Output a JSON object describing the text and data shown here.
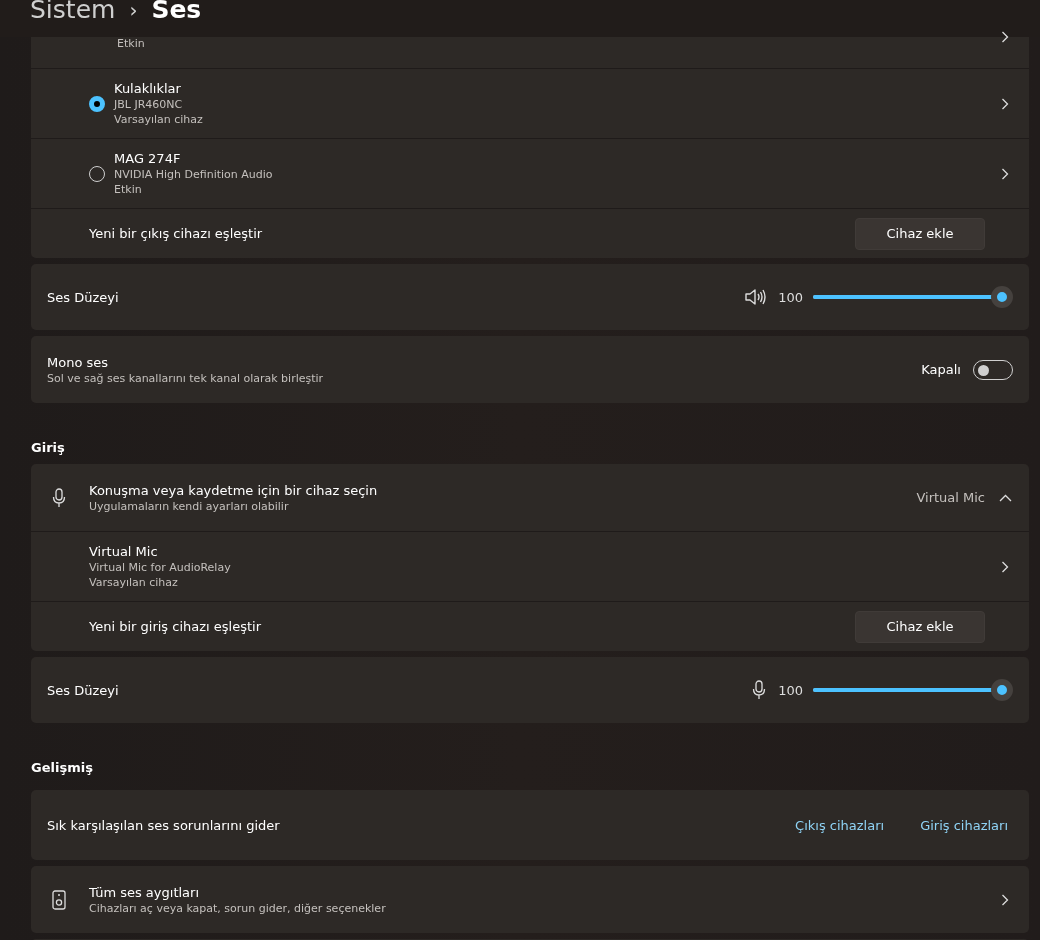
{
  "breadcrumb": {
    "parent": "Sistem",
    "separator": "›",
    "current": "Ses"
  },
  "output": {
    "clipped_device": {
      "status": "Etkin"
    },
    "devices": [
      {
        "name": "Kulaklıklar",
        "description": "JBL JR460NC",
        "status": "Varsayılan cihaz",
        "selected": true
      },
      {
        "name": "MAG 274F",
        "description": "NVIDIA High Definition Audio",
        "status": "Etkin",
        "selected": false
      }
    ],
    "pair": {
      "label": "Yeni bir çıkış cihazı eşleştir",
      "button": "Cihaz ekle"
    },
    "volume": {
      "label": "Ses Düzeyi",
      "value": "100",
      "level": 1.0
    },
    "mono": {
      "title": "Mono ses",
      "subtitle": "Sol ve sağ ses kanallarını tek kanal olarak birleştir",
      "state_label": "Kapalı",
      "on": false
    }
  },
  "input": {
    "heading": "Giriş",
    "chooser": {
      "title": "Konuşma veya kaydetme için bir cihaz seçin",
      "subtitle": "Uygulamaların kendi ayarları olabilir",
      "value": "Virtual Mic",
      "expanded": true
    },
    "devices": [
      {
        "name": "Virtual Mic",
        "description": "Virtual Mic for AudioRelay",
        "status": "Varsayılan cihaz"
      }
    ],
    "pair": {
      "label": "Yeni bir giriş cihazı eşleştir",
      "button": "Cihaz ekle"
    },
    "volume": {
      "label": "Ses Düzeyi",
      "value": "100",
      "level": 1.0
    }
  },
  "advanced": {
    "heading": "Gelişmiş",
    "troubleshoot": {
      "label": "Sık karşılaşılan ses sorunlarını gider",
      "links": [
        "Çıkış cihazları",
        "Giriş cihazları"
      ]
    },
    "all_devices": {
      "title": "Tüm ses aygıtları",
      "subtitle": "Cihazları aç veya kapat, sorun gider, diğer seçenekler"
    }
  }
}
